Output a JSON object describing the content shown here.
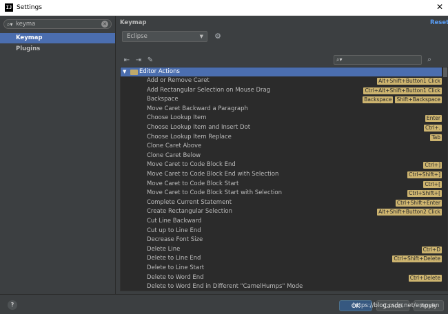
{
  "window": {
    "title": "Settings",
    "app_icon_text": "IJ"
  },
  "sidebar": {
    "search": {
      "value": "keyma"
    },
    "items": [
      {
        "label": "Keymap",
        "selected": true
      },
      {
        "label": "Plugins",
        "selected": false
      }
    ]
  },
  "main": {
    "title": "Keymap",
    "reset_label": "Reset",
    "scheme": "Eclipse",
    "group": "Editor Actions",
    "actions": [
      {
        "label": "Add or Remove Caret",
        "shortcuts": [
          "Alt+Shift+Button1 Click"
        ]
      },
      {
        "label": "Add Rectangular Selection on Mouse Drag",
        "shortcuts": [
          "Ctrl+Alt+Shift+Button1 Click"
        ]
      },
      {
        "label": "Backspace",
        "shortcuts": [
          "Backspace",
          "Shift+Backspace"
        ]
      },
      {
        "label": "Move Caret Backward a Paragraph",
        "shortcuts": []
      },
      {
        "label": "Choose Lookup Item",
        "shortcuts": [
          "Enter"
        ]
      },
      {
        "label": "Choose Lookup Item and Insert Dot",
        "shortcuts": [
          "Ctrl+."
        ]
      },
      {
        "label": "Choose Lookup Item Replace",
        "shortcuts": [
          "Tab"
        ]
      },
      {
        "label": "Clone Caret Above",
        "shortcuts": []
      },
      {
        "label": "Clone Caret Below",
        "shortcuts": []
      },
      {
        "label": "Move Caret to Code Block End",
        "shortcuts": [
          "Ctrl+]"
        ]
      },
      {
        "label": "Move Caret to Code Block End with Selection",
        "shortcuts": [
          "Ctrl+Shift+]"
        ]
      },
      {
        "label": "Move Caret to Code Block Start",
        "shortcuts": [
          "Ctrl+["
        ]
      },
      {
        "label": "Move Caret to Code Block Start with Selection",
        "shortcuts": [
          "Ctrl+Shift+["
        ]
      },
      {
        "label": "Complete Current Statement",
        "shortcuts": [
          "Ctrl+Shift+Enter"
        ]
      },
      {
        "label": "Create Rectangular Selection",
        "shortcuts": [
          "Alt+Shift+Button2 Click"
        ]
      },
      {
        "label": "Cut Line Backward",
        "shortcuts": []
      },
      {
        "label": "Cut up to Line End",
        "shortcuts": []
      },
      {
        "label": "Decrease Font Size",
        "shortcuts": []
      },
      {
        "label": "Delete Line",
        "shortcuts": [
          "Ctrl+D"
        ]
      },
      {
        "label": "Delete to Line End",
        "shortcuts": [
          "Ctrl+Shift+Delete"
        ]
      },
      {
        "label": "Delete to Line Start",
        "shortcuts": []
      },
      {
        "label": "Delete to Word End",
        "shortcuts": [
          "Ctrl+Delete"
        ]
      },
      {
        "label": "Delete to Word End in Different \"CamelHumps\" Mode",
        "shortcuts": []
      }
    ]
  },
  "footer": {
    "help_label": "?",
    "ok_label": "OK",
    "cancel_label": "Cancel",
    "apply_label": "Apply",
    "watermark": "https://blog.csdn.net/emoven"
  },
  "icons": {
    "expand_all": "expand-all-icon",
    "collapse_all": "collapse-all-icon",
    "edit": "pencil-icon",
    "settings": "gear-icon",
    "find_by_shortcut": "find-shortcut-icon"
  },
  "colors": {
    "selection": "#4b6eaf",
    "shortcut_badge": "#cdb46f",
    "link": "#589df6",
    "background": "#3c3f41",
    "tree_background": "#2b2b2b"
  }
}
